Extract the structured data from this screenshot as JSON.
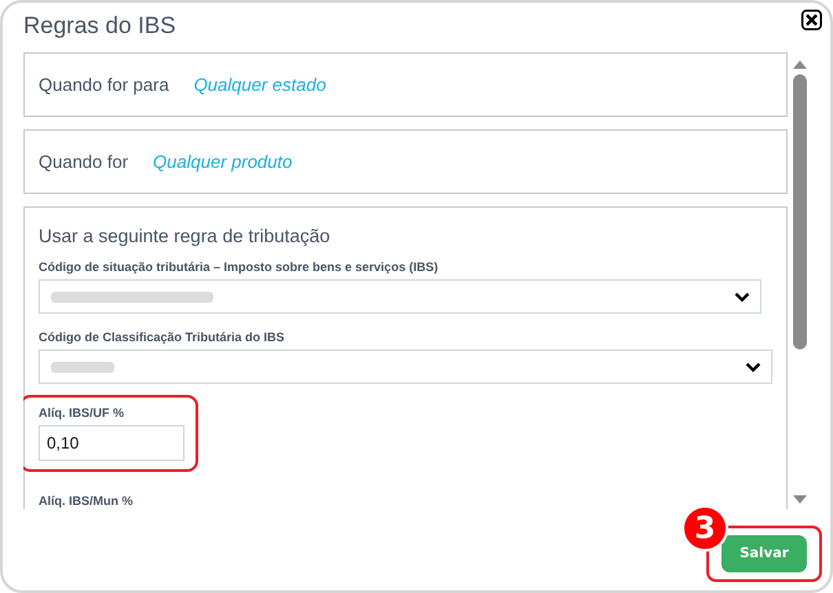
{
  "dialog": {
    "title": "Regras do IBS"
  },
  "conditions": [
    {
      "label": "Quando for para",
      "value": "Qualquer estado"
    },
    {
      "label": "Quando for",
      "value": "Qualquer produto"
    }
  ],
  "rule": {
    "heading": "Usar a seguinte regra de tributação",
    "fields": [
      {
        "kind": "select",
        "label": "Código de situação tributária – Imposto sobre bens e serviços (IBS)",
        "highlighted": false
      },
      {
        "kind": "select",
        "label": "Código de Classificação Tributária do IBS",
        "highlighted": false
      },
      {
        "kind": "input",
        "label": "Alíq. IBS/UF %",
        "value": "0,10",
        "highlighted": true
      },
      {
        "kind": "input",
        "label": "Alíq. IBS/Mun %",
        "highlighted": false
      }
    ]
  },
  "footer": {
    "button": "Salvar",
    "step_badge": "3",
    "highlighted": true
  }
}
